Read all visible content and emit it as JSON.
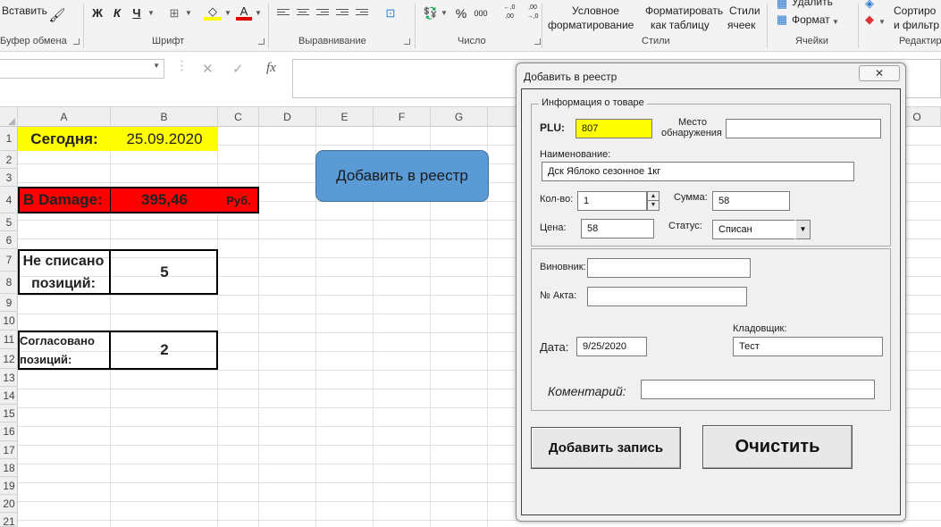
{
  "ribbon": {
    "paste": "Вставить",
    "bold": "Ж",
    "italic": "К",
    "underline": "Ч",
    "font_color_letter": "А",
    "percent": "%",
    "thousands": "000",
    "dec_inc": "←,0 ,00",
    "dec_dec": ",00 →,0",
    "cond_format": [
      "Условное",
      "форматирование"
    ],
    "format_as_table": [
      "Форматировать",
      "как таблицу"
    ],
    "cell_styles": [
      "Стили",
      "ячеек"
    ],
    "delete": "Удалить",
    "format": "Формат",
    "sort_filter": [
      "Сортиро",
      "и фильтр"
    ],
    "groups": {
      "clipboard": "Буфер обмена",
      "font": "Шрифт",
      "alignment": "Выравнивание",
      "number": "Число",
      "styles": "Стили",
      "cells": "Ячейки",
      "editing": "Редактир"
    },
    "colors": {
      "highlight": "#ffff00",
      "font_red": "#e00000"
    }
  },
  "formula_bar": {
    "cancel": "✕",
    "enter": "✓",
    "fx": "fx",
    "value": ""
  },
  "grid": {
    "columns": [
      "A",
      "B",
      "C",
      "D",
      "E",
      "F",
      "G",
      "O"
    ],
    "rows": [
      "1",
      "2",
      "3",
      "4",
      "5",
      "6",
      "7",
      "8",
      "9",
      "10",
      "11",
      "12",
      "13",
      "14",
      "15",
      "16",
      "17",
      "18",
      "19",
      "20",
      "21"
    ],
    "cells": {
      "today_label": "Сегодня:",
      "today_value": "25.09.2020",
      "damage_label": "В Damage:",
      "damage_value": "395,46",
      "damage_unit": "Руб.",
      "not_written_label": [
        "Не списано",
        "позиций:"
      ],
      "not_written_value": "5",
      "agreed_label": [
        "Согласовано",
        "позиций:"
      ],
      "agreed_value": "2"
    },
    "shape_button": "Добавить в реестр",
    "colors": {
      "yellow": "#ffff00",
      "red": "#ff0000",
      "shape": "#5b9bd5"
    }
  },
  "dialog": {
    "title": "Добавить в реестр",
    "close": "✕",
    "frame_caption": "Информация о товаре",
    "plu_label": "PLU:",
    "plu_value": "807",
    "location_label": [
      "Место",
      "обнаружения"
    ],
    "location_value": "",
    "name_label": "Наименование:",
    "name_value": "Дск Яблоко сезонное 1кг",
    "qty_label": "Кол-во:",
    "qty_value": "1",
    "sum_label": "Сумма:",
    "sum_value": "58",
    "price_label": "Цена:",
    "price_value": "58",
    "status_label": "Статус:",
    "status_value": "Списан",
    "culprit_label": "Виновник:",
    "culprit_value": "",
    "act_label": "№ Акта:",
    "act_value": "",
    "date_label": "Дата:",
    "date_value": "9/25/2020",
    "storekeeper_label": "Кладовщик:",
    "storekeeper_value": "Тест",
    "comment_label": "Коментарий:",
    "comment_value": "",
    "add_button": "Добавить запись",
    "clear_button": "Очистить",
    "colors": {
      "plu_highlight": "#ffff00"
    }
  }
}
